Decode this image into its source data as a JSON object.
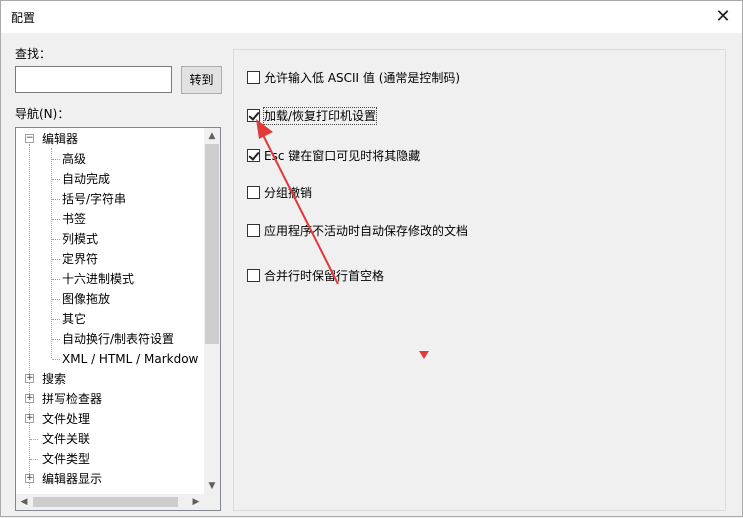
{
  "window": {
    "title": "配置",
    "close_glyph": "✕"
  },
  "search": {
    "label": "查找：",
    "value": "",
    "placeholder": "",
    "goto_label": "转到"
  },
  "nav": {
    "label": "导航(N)：",
    "items": [
      {
        "label": "编辑器",
        "expander": "−"
      },
      {
        "label": "高级"
      },
      {
        "label": "自动完成"
      },
      {
        "label": "括号/字符串"
      },
      {
        "label": "书签"
      },
      {
        "label": "列模式"
      },
      {
        "label": "定界符"
      },
      {
        "label": "十六进制模式"
      },
      {
        "label": "图像拖放"
      },
      {
        "label": "其它"
      },
      {
        "label": "自动换行/制表符设置"
      },
      {
        "label": "XML / HTML / Markdow"
      },
      {
        "label": "搜索",
        "expander": "+"
      },
      {
        "label": "拼写检查器",
        "expander": "+"
      },
      {
        "label": "文件处理",
        "expander": "+"
      },
      {
        "label": "文件关联"
      },
      {
        "label": "文件类型"
      },
      {
        "label": "编辑器显示",
        "expander": "+"
      }
    ]
  },
  "options": [
    {
      "label": "允许输入低 ASCII 值 (通常是控制码)",
      "checked": false
    },
    {
      "label": "加载/恢复打印机设置",
      "checked": true
    },
    {
      "label": "Esc 键在窗口可见时将其隐藏",
      "checked": true
    },
    {
      "label": "分组撤销",
      "checked": false
    },
    {
      "label": "应用程序不活动时自动保存修改的文档",
      "checked": false
    },
    {
      "label": "合并行时保留行首空格",
      "checked": false
    }
  ],
  "icons": {
    "scroll_up": "▲",
    "scroll_down": "▼",
    "scroll_left": "◀",
    "scroll_right": "▶"
  },
  "colors": {
    "annotation": "#e03a3a"
  }
}
